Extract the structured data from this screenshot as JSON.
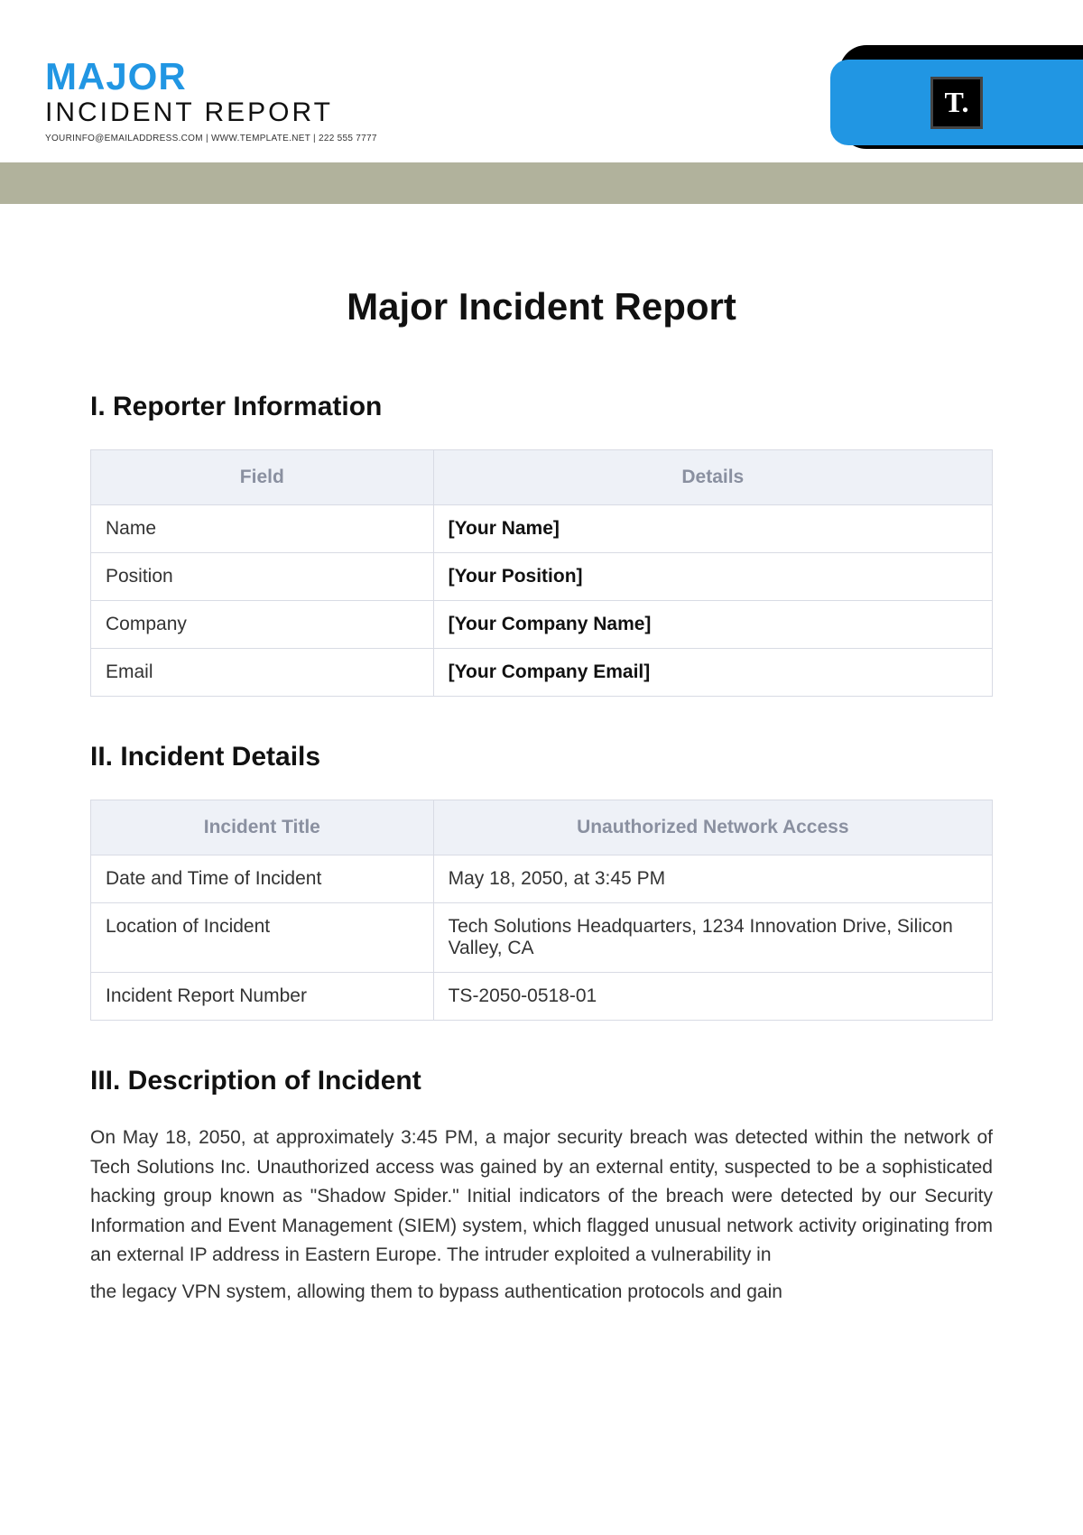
{
  "header": {
    "word1": "MAJOR",
    "word2": "INCIDENT REPORT",
    "contact": "YOURINFO@EMAILADDRESS.COM | WWW.TEMPLATE.NET | 222 555 7777",
    "badge": "T."
  },
  "doc_title": "Major Incident Report",
  "section1": {
    "heading": "I. Reporter Information",
    "col1": "Field",
    "col2": "Details",
    "rows": [
      {
        "f": "Name",
        "d": "[Your Name]"
      },
      {
        "f": "Position",
        "d": "[Your Position]"
      },
      {
        "f": "Company",
        "d": "[Your Company Name]"
      },
      {
        "f": "Email",
        "d": "[Your Company Email]"
      }
    ]
  },
  "section2": {
    "heading": "II. Incident Details",
    "col1": "Incident Title",
    "col2": "Unauthorized Network Access",
    "rows": [
      {
        "f": "Date and Time of Incident",
        "d": "May 18, 2050, at 3:45 PM"
      },
      {
        "f": "Location of Incident",
        "d": "Tech Solutions Headquarters, 1234 Innovation Drive, Silicon Valley, CA"
      },
      {
        "f": "Incident Report Number",
        "d": "TS-2050-0518-01"
      }
    ]
  },
  "section3": {
    "heading": "III. Description of Incident",
    "para1": "On May 18, 2050, at approximately 3:45 PM, a major security breach was detected within the network of Tech Solutions Inc. Unauthorized access was gained by an external entity, suspected to be a sophisticated hacking group known as \"Shadow Spider.\" Initial indicators of the breach were detected by our Security Information and Event Management (SIEM) system, which flagged unusual network activity originating from an external IP address in Eastern Europe. The intruder exploited a vulnerability in",
    "para2": "the legacy VPN system, allowing them to bypass authentication protocols and gain"
  }
}
